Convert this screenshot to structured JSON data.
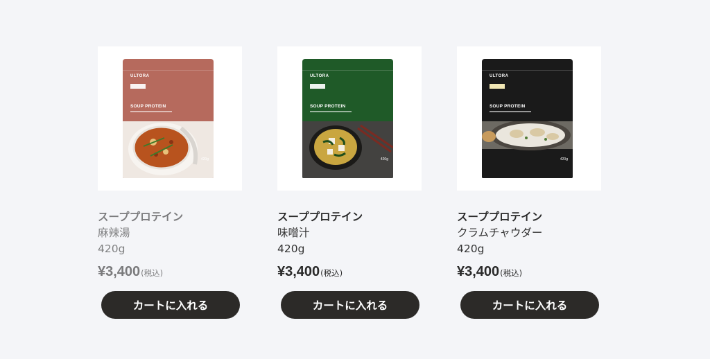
{
  "products": [
    {
      "category": "スーププロテイン",
      "flavor": "麻辣湯",
      "weight": "420g",
      "price": "¥3,400",
      "tax_note": "(税込)",
      "button_label": "カートに入れる",
      "package": {
        "brand": "ULTORA",
        "product_name": "SOUP PROTEIN",
        "net_weight": "420g",
        "color": "#b66a5d",
        "style": "faded"
      }
    },
    {
      "category": "スーププロテイン",
      "flavor": "味噌汁",
      "weight": "420g",
      "price": "¥3,400",
      "tax_note": "(税込)",
      "button_label": "カートに入れる",
      "package": {
        "brand": "ULTORA",
        "product_name": "SOUP PROTEIN",
        "net_weight": "420g",
        "color": "#1f5a28"
      }
    },
    {
      "category": "スーププロテイン",
      "flavor": "クラムチャウダー",
      "weight": "420g",
      "price": "¥3,400",
      "tax_note": "(税込)",
      "button_label": "カートに入れる",
      "package": {
        "brand": "ULTORA",
        "product_name": "SOUP PROTEIN",
        "net_weight": "420g",
        "color": "#1a1a1a"
      }
    }
  ]
}
